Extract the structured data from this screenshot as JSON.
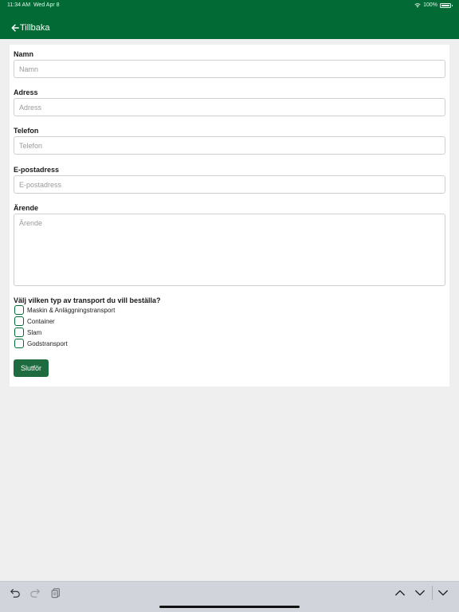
{
  "status_bar": {
    "time": "11:34 AM",
    "date": "Wed Apr 8",
    "battery": "100%",
    "icons": [
      "wifi-icon",
      "battery-icon"
    ]
  },
  "header": {
    "back_label": "Tillbaka",
    "back_icon": "arrow-left-icon",
    "color": "#026a34"
  },
  "form": {
    "fields": [
      {
        "label": "Namn",
        "placeholder": "Namn",
        "value": ""
      },
      {
        "label": "Adress",
        "placeholder": "Adress",
        "value": ""
      },
      {
        "label": "Telefon",
        "placeholder": "Telefon",
        "value": ""
      },
      {
        "label": "E-postadress",
        "placeholder": "E-postadress",
        "value": ""
      },
      {
        "label": "Ärende",
        "placeholder": "Ärende",
        "value": ""
      }
    ],
    "transport_question": "Välj vilken typ av transport du vill beställa?",
    "transport_options": [
      {
        "label": "Maskin & Anläggningstransport",
        "checked": false
      },
      {
        "label": "Container",
        "checked": false
      },
      {
        "label": "Slam",
        "checked": false
      },
      {
        "label": "Godstransport",
        "checked": false
      }
    ],
    "submit_label": "Slutför",
    "accent_color": "#1d6b3f"
  },
  "keyboard_toolbar": {
    "icons": [
      "undo-icon",
      "redo-icon",
      "clipboard-icon",
      "chevron-up-icon",
      "chevron-down-icon",
      "dismiss-keyboard-icon"
    ]
  }
}
